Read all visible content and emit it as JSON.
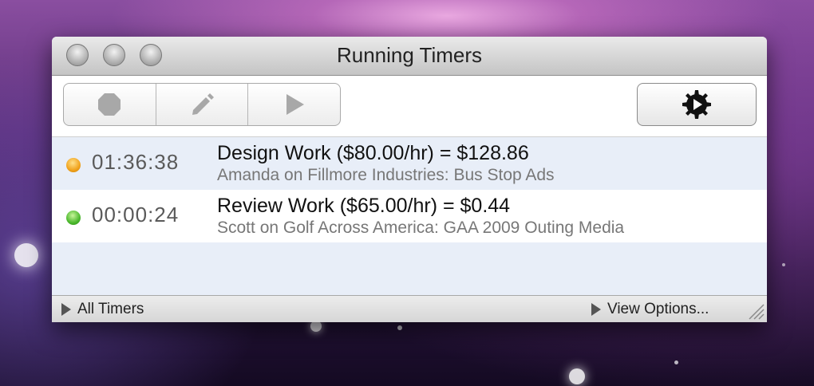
{
  "window": {
    "title": "Running Timers"
  },
  "toolbar": {
    "stop_icon": "stop-icon",
    "edit_icon": "pencil-icon",
    "resume_icon": "play-icon",
    "action_icon": "gear-play-icon"
  },
  "timers": [
    {
      "status_color": "#f0a21c",
      "elapsed": "01:36:38",
      "title": "Design Work ($80.00/hr) = $128.86",
      "subtitle": "Amanda on Fillmore Industries: Bus Stop Ads"
    },
    {
      "status_color": "#4bb82d",
      "elapsed": "00:00:24",
      "title": "Review Work ($65.00/hr) = $0.44",
      "subtitle": "Scott on Golf Across America: GAA 2009 Outing Media"
    }
  ],
  "statusbar": {
    "left_label": "All Timers",
    "right_label": "View Options..."
  }
}
